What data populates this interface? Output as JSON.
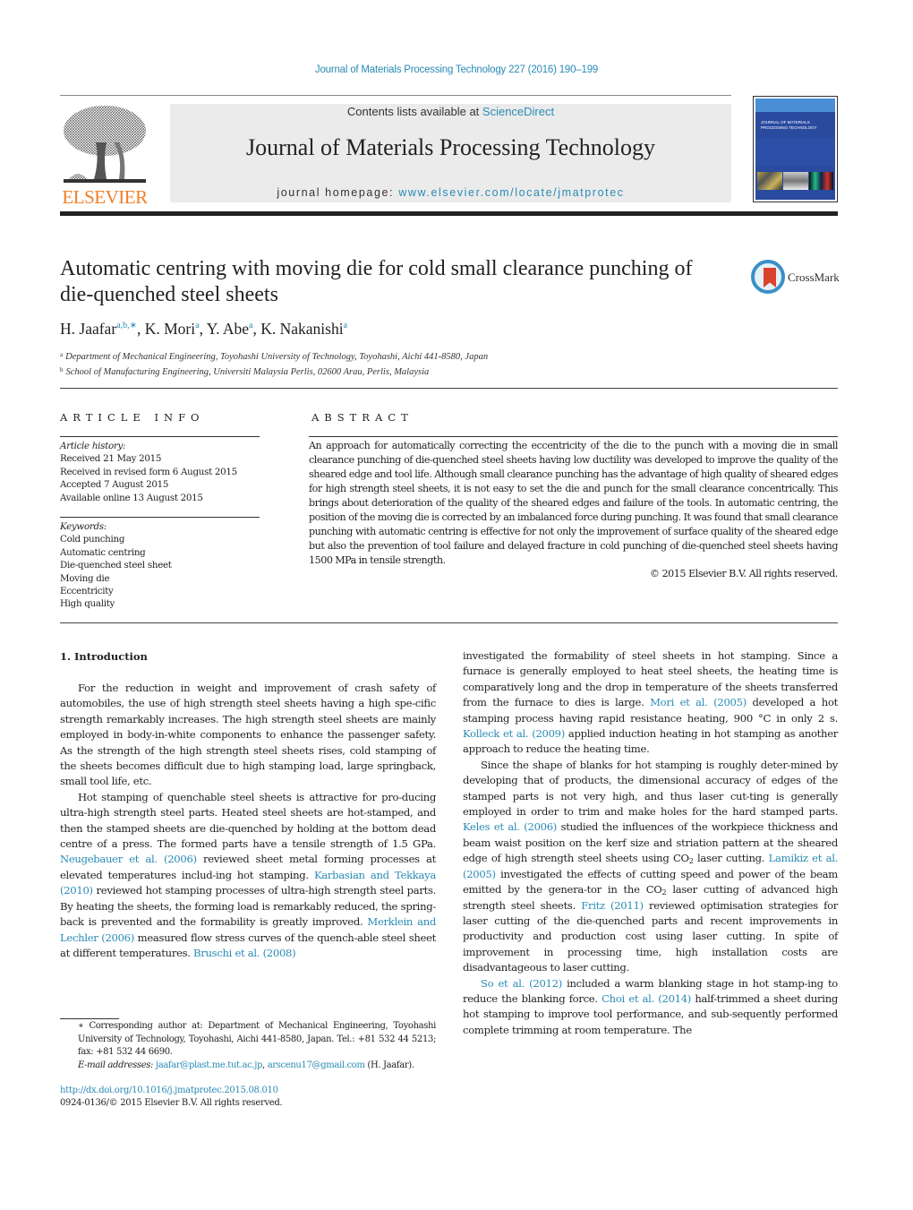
{
  "header": {
    "journal_ref": "Journal of Materials Processing Technology 227 (2016) 190–199",
    "contents_prefix": "Contents lists available at ",
    "contents_link": "ScienceDirect",
    "journal_title": "Journal of Materials Processing Technology",
    "homepage_prefix": "journal homepage: ",
    "homepage_link": "www.elsevier.com/locate/jmatprotec",
    "publisher_logo_text": "ELSEVIER",
    "cover_title": "JOURNAL OF MATERIALS PROCESSING TECHNOLOGY",
    "crossmark_label": "CrossMark"
  },
  "article": {
    "title": "Automatic centring with moving die for cold small clearance punching of die-quenched steel sheets",
    "authors": [
      {
        "name": "H. Jaafar",
        "sup": "a,b,∗"
      },
      {
        "name": "K. Mori",
        "sup": "a"
      },
      {
        "name": "Y. Abe",
        "sup": "a"
      },
      {
        "name": "K. Nakanishi",
        "sup": "a"
      }
    ],
    "affiliations": [
      {
        "mark": "a",
        "text": "Department of Mechanical Engineering, Toyohashi University of Technology, Toyohashi, Aichi 441-8580, Japan"
      },
      {
        "mark": "b",
        "text": "School of Manufacturing Engineering, Universiti Malaysia Perlis, 02600 Arau, Perlis, Malaysia"
      }
    ]
  },
  "article_info": {
    "heading": "ARTICLE INFO",
    "history_label": "Article history:",
    "history": [
      "Received 21 May 2015",
      "Received in revised form 6 August 2015",
      "Accepted 7 August 2015",
      "Available online 13 August 2015"
    ],
    "keywords_label": "Keywords:",
    "keywords": [
      "Cold punching",
      "Automatic centring",
      "Die-quenched steel sheet",
      "Moving die",
      "Eccentricity",
      "High quality"
    ]
  },
  "abstract": {
    "heading": "ABSTRACT",
    "text": "An approach for automatically correcting the eccentricity of the die to the punch with a moving die in small clearance punching of die-quenched steel sheets having low ductility was developed to improve the quality of the sheared edge and tool life. Although small clearance punching has the advantage of high quality of sheared edges for high strength steel sheets, it is not easy to set the die and punch for the small clearance concentrically. This brings about deterioration of the quality of the sheared edges and failure of the tools. In automatic centring, the position of the moving die is corrected by an imbalanced force during punching. It was found that small clearance punching with automatic centring is effective for not only the improvement of surface quality of the sheared edge but also the prevention of tool failure and delayed fracture in cold punching of die-quenched steel sheets having 1500 MPa in tensile strength.",
    "copyright": "© 2015 Elsevier B.V. All rights reserved."
  },
  "body": {
    "section_heading": "1.  Introduction",
    "left": {
      "p1": "For the reduction in weight and improvement of crash safety of automobiles, the use of high strength steel sheets having a high spe-cific strength remarkably increases. The high strength steel sheets are mainly employed in body-in-white components to enhance the passenger safety. As the strength of the high strength steel sheets rises, cold stamping of the sheets becomes difficult due to high stamping load, large springback, small tool life, etc.",
      "p2_a": "Hot stamping of quenchable steel sheets is attractive for pro-ducing ultra-high strength steel parts. Heated steel sheets are hot-stamped, and then the stamped sheets are die-quenched by holding at the bottom dead centre of a press. The formed parts have a tensile strength of 1.5 GPa. ",
      "cite_neugebauer": "Neugebauer et al. (2006)",
      "p2_b": " reviewed sheet metal forming processes at elevated temperatures includ-ing hot stamping. ",
      "cite_karbasian": "Karbasian and Tekkaya (2010)",
      "p2_c": " reviewed hot stamping processes of ultra-high strength steel parts. By heating the sheets, the forming load is remarkably reduced, the spring-back is prevented and the formability is greatly improved. ",
      "cite_merklein": "Merklein and Lechler (2006)",
      "p2_d": " measured flow stress curves of the quench-able steel sheet at different temperatures. ",
      "cite_bruschi": "Bruschi et al. (2008)"
    },
    "right": {
      "p1_a": "investigated the formability of steel sheets in hot stamping. Since a furnace is generally employed to heat steel sheets, the heating time is comparatively long and the drop in temperature of the sheets transferred from the furnace to dies is large. ",
      "cite_mori": "Mori et al. (2005)",
      "p1_b": " developed a hot stamping process having rapid resistance heating, 900 °C in only 2 s. ",
      "cite_kolleck": "Kolleck et al. (2009)",
      "p1_c": " applied induction heating in hot stamping as another approach to reduce the heating time.",
      "p2_a": "Since the shape of blanks for hot stamping is roughly deter-mined by developing that of products, the dimensional accuracy of edges of the stamped parts is not very high, and thus laser cut-ting is generally employed in order to trim and make holes for the hard stamped parts. ",
      "cite_keles": "Keles et al. (2006)",
      "p2_b": " studied the influences of the workpiece thickness and beam waist position on the kerf size and striation pattern at the sheared edge of high strength steel sheets using CO",
      "p2_c": " laser cutting. ",
      "cite_lamikiz": "Lamikiz et al. (2005)",
      "p2_d": " investigated the effects of cutting speed and power of the beam emitted by the genera-tor in the CO",
      "p2_e": " laser cutting of advanced high strength steel sheets. ",
      "cite_fritz": "Fritz (2011)",
      "p2_f": " reviewed optimisation strategies for laser cutting of the die-quenched parts and recent improvements in productivity and production cost using laser cutting. In spite of improvement in processing time, high installation costs are disadvantageous to laser cutting.",
      "sub_2": "2",
      "cite_so": "So et al. (2012)",
      "p3_a": " included a warm blanking stage in hot stamp-ing to reduce the blanking force. ",
      "cite_choi": "Choi et al. (2014)",
      "p3_b": " half-trimmed a sheet during hot stamping to improve tool performance, and sub-sequently performed complete trimming at room temperature. The"
    }
  },
  "footnote": {
    "corresponding": "∗ Corresponding author at: Department of Mechanical Engineering, Toyohashi University of Technology, Toyohashi, Aichi 441-8580, Japan. Tel.: +81 532 44 5213; fax: +81 532 44 6690.",
    "email_label": "E-mail addresses:",
    "email1": "jaafar@plast.me.tut.ac.jp",
    "email2": "arscenu17@gmail.com",
    "email_owner": " (H. Jaafar).",
    "doi": "http://dx.doi.org/10.1016/j.jmatprotec.2015.08.010",
    "issn": "0924-0136/© 2015 Elsevier B.V. All rights reserved."
  }
}
